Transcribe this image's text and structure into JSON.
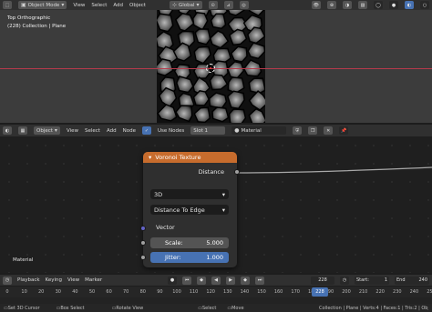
{
  "viewport": {
    "header": {
      "mode_label": "Object Mode",
      "menus": [
        "View",
        "Select",
        "Add",
        "Object"
      ],
      "orientation_label": "Global"
    },
    "overlay_title": "Top Orthographic",
    "overlay_collection": "(228) Collection | Plane"
  },
  "node_editor": {
    "header": {
      "object_label": "Object",
      "menus": [
        "View",
        "Select",
        "Add",
        "Node"
      ],
      "use_nodes_label": "Use Nodes",
      "slot_label": "Slot 1",
      "material_label": "Material"
    },
    "material_label": "Material",
    "node": {
      "title": "Voronoi Texture",
      "output_label": "Distance",
      "dimension_value": "3D",
      "feature_value": "Distance To Edge",
      "vector_label": "Vector",
      "scale_label": "Scale:",
      "scale_value": "5.000",
      "jitter_label": "Jitter:",
      "jitter_value": "1.000"
    }
  },
  "timeline": {
    "header": {
      "menus": [
        "Playback",
        "Keying",
        "View",
        "Marker"
      ],
      "current_frame": "228",
      "start_label": "Start:",
      "start_value": "1",
      "end_label": "End",
      "end_value": "240"
    },
    "ruler_ticks": [
      "0",
      "10",
      "20",
      "30",
      "40",
      "50",
      "60",
      "70",
      "80",
      "90",
      "100",
      "110",
      "120",
      "130",
      "140",
      "150",
      "160",
      "170",
      "180",
      "190",
      "200",
      "210",
      "220",
      "230",
      "240",
      "250"
    ],
    "playhead_label": "228"
  },
  "status_bar": {
    "left": [
      {
        "label": "Set 3D Cursor"
      },
      {
        "label": "Box Select"
      },
      {
        "label": "Rotate View"
      },
      {
        "label": "Select"
      },
      {
        "label": "Move"
      }
    ],
    "stats": "Collection | Plane | Verts:4 | Faces:1 | Tris:2 | Objects:1/1 | Mem: 31.1 MiB | 2.90.0"
  }
}
